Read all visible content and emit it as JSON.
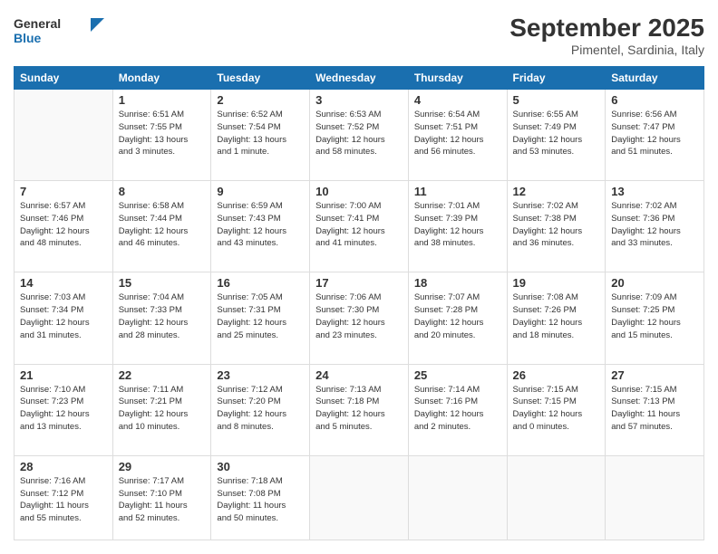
{
  "header": {
    "logo_general": "General",
    "logo_blue": "Blue",
    "month_title": "September 2025",
    "subtitle": "Pimentel, Sardinia, Italy"
  },
  "days_of_week": [
    "Sunday",
    "Monday",
    "Tuesday",
    "Wednesday",
    "Thursday",
    "Friday",
    "Saturday"
  ],
  "weeks": [
    [
      {
        "day": "",
        "info": ""
      },
      {
        "day": "1",
        "info": "Sunrise: 6:51 AM\nSunset: 7:55 PM\nDaylight: 13 hours\nand 3 minutes."
      },
      {
        "day": "2",
        "info": "Sunrise: 6:52 AM\nSunset: 7:54 PM\nDaylight: 13 hours\nand 1 minute."
      },
      {
        "day": "3",
        "info": "Sunrise: 6:53 AM\nSunset: 7:52 PM\nDaylight: 12 hours\nand 58 minutes."
      },
      {
        "day": "4",
        "info": "Sunrise: 6:54 AM\nSunset: 7:51 PM\nDaylight: 12 hours\nand 56 minutes."
      },
      {
        "day": "5",
        "info": "Sunrise: 6:55 AM\nSunset: 7:49 PM\nDaylight: 12 hours\nand 53 minutes."
      },
      {
        "day": "6",
        "info": "Sunrise: 6:56 AM\nSunset: 7:47 PM\nDaylight: 12 hours\nand 51 minutes."
      }
    ],
    [
      {
        "day": "7",
        "info": "Sunrise: 6:57 AM\nSunset: 7:46 PM\nDaylight: 12 hours\nand 48 minutes."
      },
      {
        "day": "8",
        "info": "Sunrise: 6:58 AM\nSunset: 7:44 PM\nDaylight: 12 hours\nand 46 minutes."
      },
      {
        "day": "9",
        "info": "Sunrise: 6:59 AM\nSunset: 7:43 PM\nDaylight: 12 hours\nand 43 minutes."
      },
      {
        "day": "10",
        "info": "Sunrise: 7:00 AM\nSunset: 7:41 PM\nDaylight: 12 hours\nand 41 minutes."
      },
      {
        "day": "11",
        "info": "Sunrise: 7:01 AM\nSunset: 7:39 PM\nDaylight: 12 hours\nand 38 minutes."
      },
      {
        "day": "12",
        "info": "Sunrise: 7:02 AM\nSunset: 7:38 PM\nDaylight: 12 hours\nand 36 minutes."
      },
      {
        "day": "13",
        "info": "Sunrise: 7:02 AM\nSunset: 7:36 PM\nDaylight: 12 hours\nand 33 minutes."
      }
    ],
    [
      {
        "day": "14",
        "info": "Sunrise: 7:03 AM\nSunset: 7:34 PM\nDaylight: 12 hours\nand 31 minutes."
      },
      {
        "day": "15",
        "info": "Sunrise: 7:04 AM\nSunset: 7:33 PM\nDaylight: 12 hours\nand 28 minutes."
      },
      {
        "day": "16",
        "info": "Sunrise: 7:05 AM\nSunset: 7:31 PM\nDaylight: 12 hours\nand 25 minutes."
      },
      {
        "day": "17",
        "info": "Sunrise: 7:06 AM\nSunset: 7:30 PM\nDaylight: 12 hours\nand 23 minutes."
      },
      {
        "day": "18",
        "info": "Sunrise: 7:07 AM\nSunset: 7:28 PM\nDaylight: 12 hours\nand 20 minutes."
      },
      {
        "day": "19",
        "info": "Sunrise: 7:08 AM\nSunset: 7:26 PM\nDaylight: 12 hours\nand 18 minutes."
      },
      {
        "day": "20",
        "info": "Sunrise: 7:09 AM\nSunset: 7:25 PM\nDaylight: 12 hours\nand 15 minutes."
      }
    ],
    [
      {
        "day": "21",
        "info": "Sunrise: 7:10 AM\nSunset: 7:23 PM\nDaylight: 12 hours\nand 13 minutes."
      },
      {
        "day": "22",
        "info": "Sunrise: 7:11 AM\nSunset: 7:21 PM\nDaylight: 12 hours\nand 10 minutes."
      },
      {
        "day": "23",
        "info": "Sunrise: 7:12 AM\nSunset: 7:20 PM\nDaylight: 12 hours\nand 8 minutes."
      },
      {
        "day": "24",
        "info": "Sunrise: 7:13 AM\nSunset: 7:18 PM\nDaylight: 12 hours\nand 5 minutes."
      },
      {
        "day": "25",
        "info": "Sunrise: 7:14 AM\nSunset: 7:16 PM\nDaylight: 12 hours\nand 2 minutes."
      },
      {
        "day": "26",
        "info": "Sunrise: 7:15 AM\nSunset: 7:15 PM\nDaylight: 12 hours\nand 0 minutes."
      },
      {
        "day": "27",
        "info": "Sunrise: 7:15 AM\nSunset: 7:13 PM\nDaylight: 11 hours\nand 57 minutes."
      }
    ],
    [
      {
        "day": "28",
        "info": "Sunrise: 7:16 AM\nSunset: 7:12 PM\nDaylight: 11 hours\nand 55 minutes."
      },
      {
        "day": "29",
        "info": "Sunrise: 7:17 AM\nSunset: 7:10 PM\nDaylight: 11 hours\nand 52 minutes."
      },
      {
        "day": "30",
        "info": "Sunrise: 7:18 AM\nSunset: 7:08 PM\nDaylight: 11 hours\nand 50 minutes."
      },
      {
        "day": "",
        "info": ""
      },
      {
        "day": "",
        "info": ""
      },
      {
        "day": "",
        "info": ""
      },
      {
        "day": "",
        "info": ""
      }
    ]
  ]
}
